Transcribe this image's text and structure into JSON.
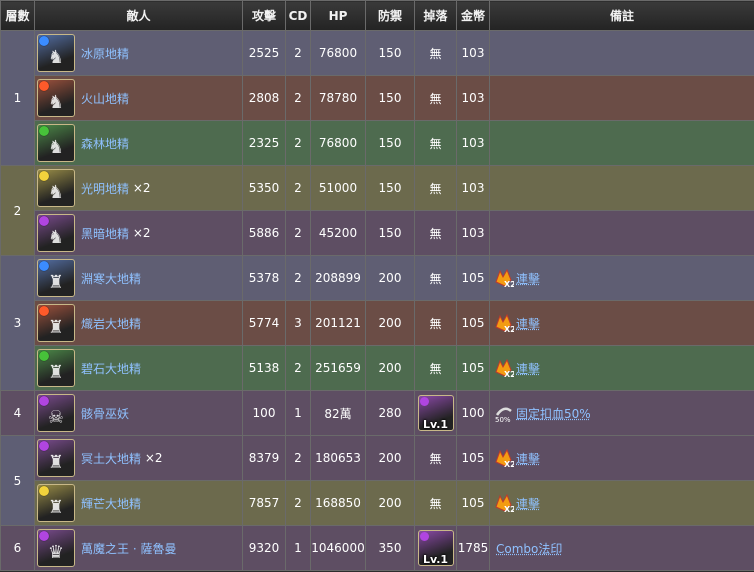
{
  "headers": [
    "層數",
    "敵人",
    "攻擊",
    "CD",
    "HP",
    "防禦",
    "掉落",
    "金幣",
    "備註"
  ],
  "floors": [
    {
      "floor": "1",
      "rows": [
        {
          "enemy": "冰原地精",
          "mult": "",
          "atk": "2525",
          "cd": "2",
          "hp": "76800",
          "def": "150",
          "drop": "無",
          "gold": "103",
          "note": "",
          "element": "water",
          "icon": "goblin-water-icon",
          "glyph": "♞"
        },
        {
          "enemy": "火山地精",
          "mult": "",
          "atk": "2808",
          "cd": "2",
          "hp": "78780",
          "def": "150",
          "drop": "無",
          "gold": "103",
          "note": "",
          "element": "fire",
          "icon": "goblin-fire-icon",
          "glyph": "♞"
        },
        {
          "enemy": "森林地精",
          "mult": "",
          "atk": "2325",
          "cd": "2",
          "hp": "76800",
          "def": "150",
          "drop": "無",
          "gold": "103",
          "note": "",
          "element": "earth",
          "icon": "goblin-earth-icon",
          "glyph": "♞"
        }
      ]
    },
    {
      "floor": "2",
      "rows": [
        {
          "enemy": "光明地精",
          "mult": "×2",
          "atk": "5350",
          "cd": "2",
          "hp": "51000",
          "def": "150",
          "drop": "無",
          "gold": "103",
          "note": "",
          "element": "light",
          "icon": "goblin-light-icon",
          "glyph": "♞"
        },
        {
          "enemy": "黑暗地精",
          "mult": "×2",
          "atk": "5886",
          "cd": "2",
          "hp": "45200",
          "def": "150",
          "drop": "無",
          "gold": "103",
          "note": "",
          "element": "dark",
          "icon": "goblin-dark-icon",
          "glyph": "♞"
        }
      ]
    },
    {
      "floor": "3",
      "rows": [
        {
          "enemy": "淵寒大地精",
          "mult": "",
          "atk": "5378",
          "cd": "2",
          "hp": "208899",
          "def": "200",
          "drop": "無",
          "gold": "105",
          "note": "連擊",
          "noteIcon": "combo-x2-icon",
          "element": "water",
          "icon": "great-goblin-water-icon",
          "glyph": "♜"
        },
        {
          "enemy": "熾岩大地精",
          "mult": "",
          "atk": "5774",
          "cd": "3",
          "hp": "201121",
          "def": "200",
          "drop": "無",
          "gold": "105",
          "note": "連擊",
          "noteIcon": "combo-x2-icon",
          "element": "fire",
          "icon": "great-goblin-fire-icon",
          "glyph": "♜"
        },
        {
          "enemy": "碧石大地精",
          "mult": "",
          "atk": "5138",
          "cd": "2",
          "hp": "251659",
          "def": "200",
          "drop": "無",
          "gold": "105",
          "note": "連擊",
          "noteIcon": "combo-x2-icon",
          "element": "earth",
          "icon": "great-goblin-earth-icon",
          "glyph": "♜"
        }
      ]
    },
    {
      "floor": "4",
      "rows": [
        {
          "enemy": "骸骨巫妖",
          "mult": "",
          "atk": "100",
          "cd": "1",
          "hp": "82萬",
          "def": "280",
          "drop": "Lv.1",
          "dropIcon": "lich-drop-icon",
          "gold": "100",
          "note": "固定扣血50%",
          "noteIcon": "fixed-damage-50-icon",
          "element": "dark",
          "icon": "lich-icon",
          "glyph": "☠"
        }
      ]
    },
    {
      "floor": "5",
      "rows": [
        {
          "enemy": "冥土大地精",
          "mult": "×2",
          "atk": "8379",
          "cd": "2",
          "hp": "180653",
          "def": "200",
          "drop": "無",
          "gold": "105",
          "note": "連擊",
          "noteIcon": "combo-x2-icon",
          "element": "dark",
          "icon": "great-goblin-dark-icon",
          "glyph": "♜"
        },
        {
          "enemy": "輝芒大地精",
          "mult": "",
          "atk": "7857",
          "cd": "2",
          "hp": "168850",
          "def": "200",
          "drop": "無",
          "gold": "105",
          "note": "連擊",
          "noteIcon": "combo-x2-icon",
          "element": "light",
          "icon": "great-goblin-light-icon",
          "glyph": "♜"
        }
      ]
    },
    {
      "floor": "6",
      "rows": [
        {
          "enemy": "萬魔之王 · 薩魯曼",
          "mult": "",
          "atk": "9320",
          "cd": "1",
          "hp": "1046000",
          "def": "350",
          "drop": "Lv.1",
          "dropIcon": "saruman-drop-icon",
          "gold": "1785",
          "note": "Combo法印",
          "noteIcon": "",
          "element": "dark",
          "icon": "saruman-icon",
          "glyph": "♛"
        }
      ]
    }
  ],
  "colors": {
    "water": "#5f5e73",
    "fire": "#6b4d46",
    "earth": "#4e6b4f",
    "light": "#6c6a4d",
    "dark": "#5e4e63",
    "link": "#8fc1ff",
    "attr_water": "#3b8cff",
    "attr_fire": "#ff5a2a",
    "attr_earth": "#47c23a",
    "attr_light": "#f2d23c",
    "attr_dark": "#b045e0"
  }
}
